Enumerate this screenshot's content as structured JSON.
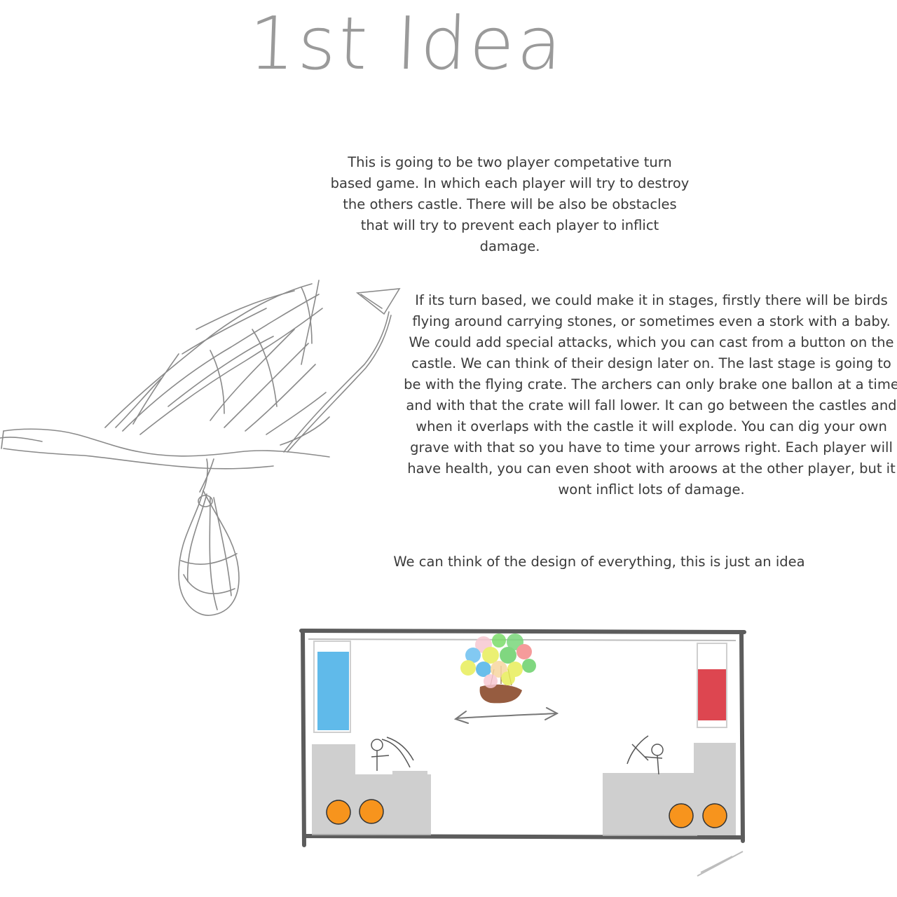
{
  "title": "1st Idea",
  "paragraphs": {
    "intro": "This is going to be two player competative turn based game. In which each player will try to destroy the others castle. There will be also be obstacles that will try to prevent each player to inflict damage.",
    "stages": "If its turn based, we could make it in stages, firstly there will be birds flying around carrying stones, or sometimes even a stork with a baby. We could add special attacks, which you can cast from a button on the castle. We can think of their design later on. The last stage is going to be with the flying crate. The archers can only brake one ballon at a time and with that the crate will fall lower. It can go between the castles and when it overlaps with the castle it will explode. You can dig your own grave with that so you have to time your arrows right. Each player will have health, you can even shoot with aroows at the other player, but it wont inflict lots of damage.",
    "note": "We can think of the design of everything, this is just an idea"
  },
  "colors": {
    "left_health": "#4fb3e8",
    "right_health": "#d9323d",
    "buttons": "#f7941d",
    "crate": "#8b4a2b"
  }
}
